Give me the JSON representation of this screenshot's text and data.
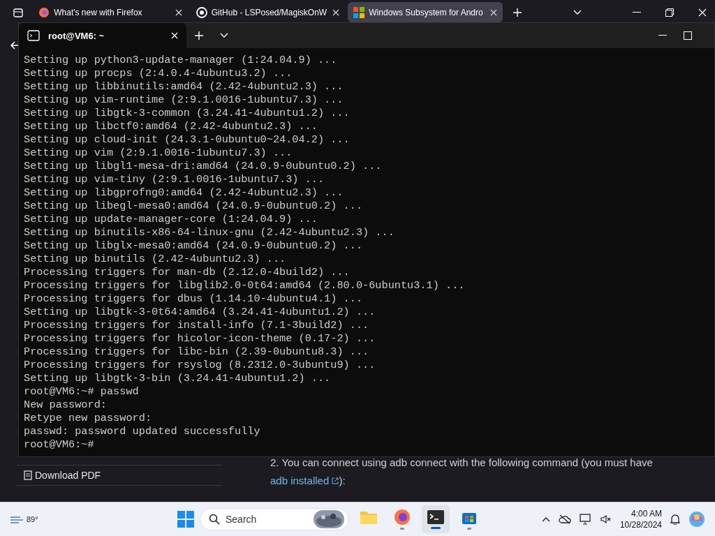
{
  "browser": {
    "tabs": [
      {
        "title": "What's new with Firefox",
        "selected": false,
        "kind": "firefox"
      },
      {
        "title": "GitHub - LSPosed/MagiskOnW",
        "selected": false,
        "kind": "github"
      },
      {
        "title": "Windows Subsystem for Andro",
        "selected": true,
        "kind": "windows"
      }
    ]
  },
  "terminal": {
    "tabs": [
      {
        "title": "root@VM6: ~",
        "selected": true
      }
    ],
    "lines": [
      "Setting up python3-update-manager (1:24.04.9) ...",
      "Setting up procps (2:4.0.4-4ubuntu3.2) ...",
      "Setting up libbinutils:amd64 (2.42-4ubuntu2.3) ...",
      "Setting up vim-runtime (2:9.1.0016-1ubuntu7.3) ...",
      "Setting up libgtk-3-common (3.24.41-4ubuntu1.2) ...",
      "Setting up libctf0:amd64 (2.42-4ubuntu2.3) ...",
      "Setting up cloud-init (24.3.1-0ubuntu0~24.04.2) ...",
      "Setting up vim (2:9.1.0016-1ubuntu7.3) ...",
      "Setting up libgl1-mesa-dri:amd64 (24.0.9-0ubuntu0.2) ...",
      "Setting up vim-tiny (2:9.1.0016-1ubuntu7.3) ...",
      "Setting up libgprofng0:amd64 (2.42-4ubuntu2.3) ...",
      "Setting up libegl-mesa0:amd64 (24.0.9-0ubuntu0.2) ...",
      "Setting up update-manager-core (1:24.04.9) ...",
      "Setting up binutils-x86-64-linux-gnu (2.42-4ubuntu2.3) ...",
      "Setting up libglx-mesa0:amd64 (24.0.9-0ubuntu0.2) ...",
      "Setting up binutils (2.42-4ubuntu2.3) ...",
      "Processing triggers for man-db (2.12.0-4build2) ...",
      "Processing triggers for libglib2.0-0t64:amd64 (2.80.0-6ubuntu3.1) ...",
      "Processing triggers for dbus (1.14.10-4ubuntu4.1) ...",
      "Setting up libgtk-3-0t64:amd64 (3.24.41-4ubuntu1.2) ...",
      "Processing triggers for install-info (7.1-3build2) ...",
      "Processing triggers for hicolor-icon-theme (0.17-2) ...",
      "Processing triggers for libc-bin (2.39-0ubuntu8.3) ...",
      "Processing triggers for rsyslog (8.2312.0-3ubuntu9) ...",
      "Setting up libgtk-3-bin (3.24.41-4ubuntu1.2) ...",
      "root@VM6:~# passwd",
      "New password:",
      "Retype new password:",
      "passwd: password updated successfully",
      "root@VM6:~#"
    ]
  },
  "page": {
    "sidebar_link": "Download PDF",
    "step_number": "2.",
    "step_text": "You can connect using adb connect with the following command (you must have",
    "step_link": "adb installed",
    "step_tail": "):"
  },
  "taskbar": {
    "weather": "89°",
    "search_placeholder": "Search",
    "time": "4:00 AM",
    "date": "10/28/2024",
    "apps": [
      {
        "kind": "files",
        "running": false
      },
      {
        "kind": "firefox",
        "running": true
      },
      {
        "kind": "terminal",
        "running": true,
        "selected": true
      },
      {
        "kind": "store",
        "running": true
      }
    ]
  }
}
